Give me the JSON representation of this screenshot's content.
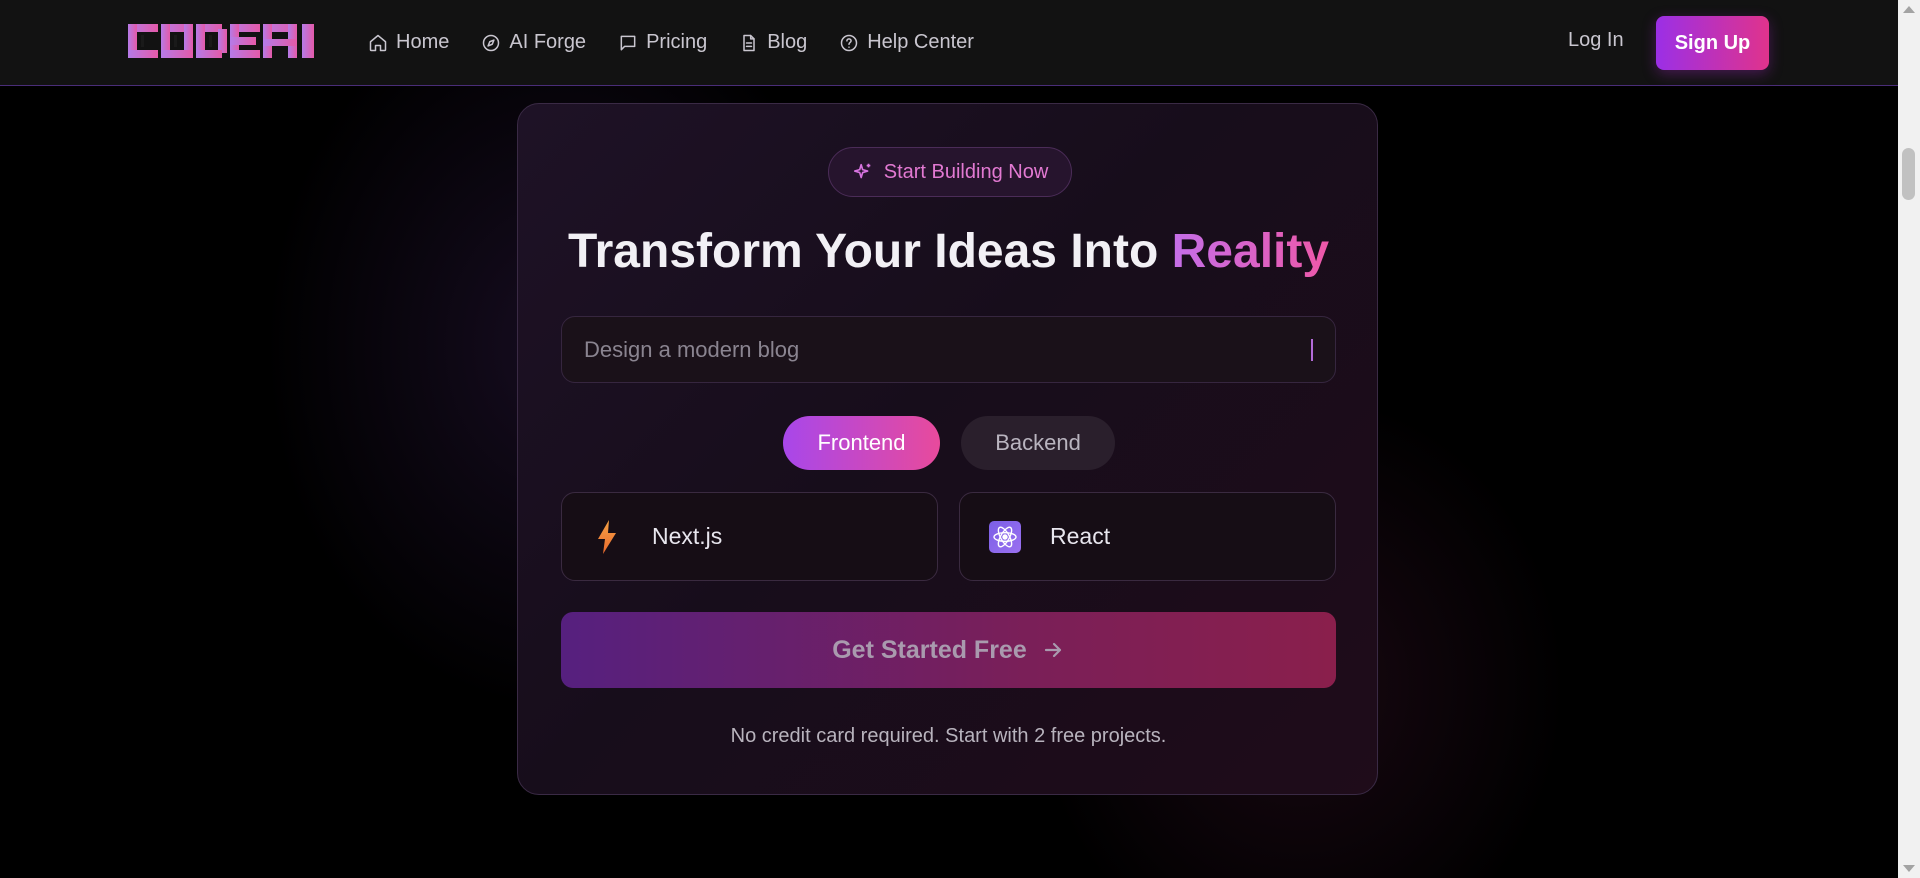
{
  "nav": {
    "logo_text": "CODEAI",
    "links": [
      {
        "label": "Home",
        "icon": "home-icon"
      },
      {
        "label": "AI Forge",
        "icon": "compass-icon"
      },
      {
        "label": "Pricing",
        "icon": "message-icon"
      },
      {
        "label": "Blog",
        "icon": "document-icon"
      },
      {
        "label": "Help Center",
        "icon": "help-circle-icon"
      }
    ],
    "login_label": "Log In",
    "signup_label": "Sign Up"
  },
  "hero": {
    "badge_label": "Start Building Now",
    "headline_main": "Transform Your Ideas Into ",
    "headline_accent": "Reality",
    "prompt_placeholder": "Design a modern blog",
    "tabs": [
      {
        "label": "Frontend",
        "active": true
      },
      {
        "label": "Backend",
        "active": false
      }
    ],
    "options": [
      {
        "label": "Next.js",
        "icon": "lightning-icon"
      },
      {
        "label": "React",
        "icon": "react-atom-icon"
      }
    ],
    "cta_label": "Get Started Free",
    "footnote": "No credit card required. Start with 2 free projects."
  },
  "colors": {
    "accent_purple": "#9b2fe6",
    "accent_pink": "#e0338c",
    "background": "#000000",
    "nav_background": "#121212"
  }
}
